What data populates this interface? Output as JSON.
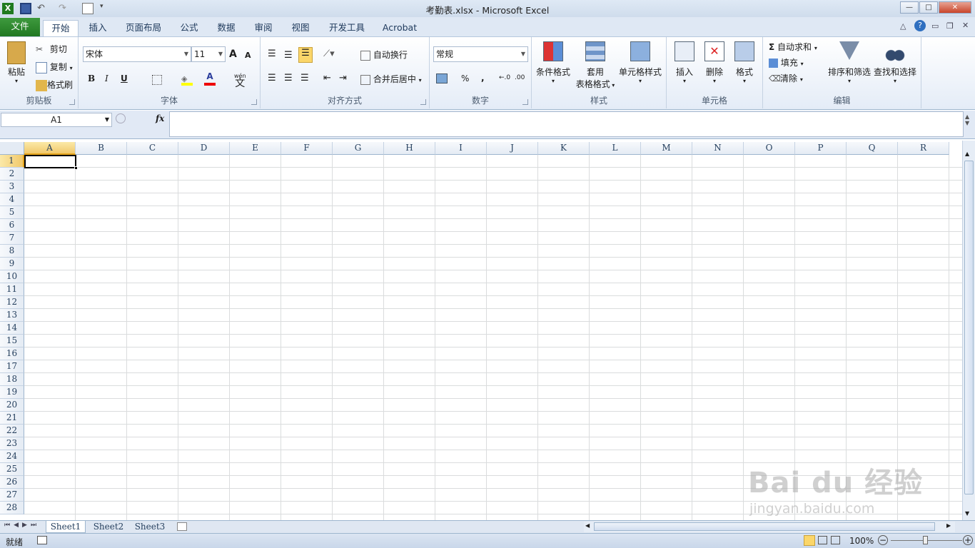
{
  "window": {
    "title": "考勤表.xlsx  -  Microsoft Excel",
    "min": "—",
    "max": "□",
    "close": "✕"
  },
  "tabs": [
    "文件",
    "开始",
    "插入",
    "页面布局",
    "公式",
    "数据",
    "审阅",
    "视图",
    "开发工具",
    "Acrobat"
  ],
  "clipboard": {
    "paste": "粘贴",
    "cut": "剪切",
    "copy": "复制",
    "painter": "格式刷",
    "group": "剪贴板"
  },
  "font": {
    "name": "宋体",
    "size": "11",
    "grow": "A",
    "shrink": "A",
    "bold": "B",
    "italic": "I",
    "underline": "U",
    "wen": "wén",
    "wen2": "文",
    "group": "字体"
  },
  "align": {
    "wrap": "自动换行",
    "merge": "合并后居中",
    "group": "对齐方式"
  },
  "number": {
    "format": "常规",
    "percent": "%",
    "comma": ",",
    "group": "数字"
  },
  "styles": {
    "cond": "条件格式",
    "table1": "套用",
    "table2": "表格格式",
    "cell": "单元格样式",
    "group": "样式"
  },
  "cells": {
    "insert": "插入",
    "delete": "删除",
    "format": "格式",
    "group": "单元格"
  },
  "editing": {
    "autosum": "自动求和",
    "fill": "填充",
    "clear": "清除",
    "sort": "排序和筛选",
    "find": "查找和选择",
    "group": "编辑",
    "sigma": "Σ"
  },
  "formula_bar": {
    "name_box": "A1",
    "fx": "fx",
    "value": ""
  },
  "columns": [
    "A",
    "B",
    "C",
    "D",
    "E",
    "F",
    "G",
    "H",
    "I",
    "J",
    "K",
    "L",
    "M",
    "N",
    "O",
    "P",
    "Q",
    "R"
  ],
  "rows": [
    "1",
    "2",
    "3",
    "4",
    "5",
    "6",
    "7",
    "8",
    "9",
    "10",
    "11",
    "12",
    "13",
    "14",
    "15",
    "16",
    "17",
    "18",
    "19",
    "20",
    "21",
    "22",
    "23",
    "24",
    "25",
    "26",
    "27",
    "28"
  ],
  "sheets": [
    "Sheet1",
    "Sheet2",
    "Sheet3"
  ],
  "status": {
    "ready": "就绪",
    "zoom": "100%"
  },
  "watermark": {
    "brand": "Bai du 经验",
    "url": "jingyan.baidu.com"
  },
  "colors": {
    "file_tab": "#217821",
    "accent": "#1e395b",
    "selection": "#000000"
  }
}
